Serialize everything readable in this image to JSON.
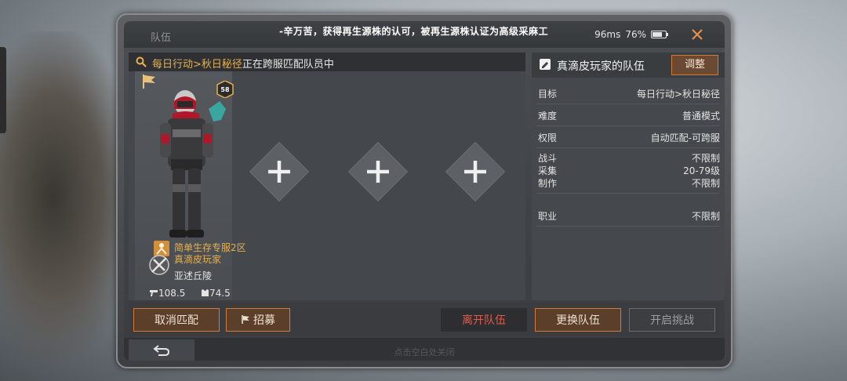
{
  "window": {
    "title": "队伍",
    "broadcast": "-辛万苦，获得再生源株的认可，被再生源株认证为高级采麻工",
    "ping": "96ms",
    "battery": "76%",
    "battery_level": 0.76
  },
  "search": {
    "highlight": "每日行动>秋日秘径",
    "status": "正在跨服匹配队员中"
  },
  "player": {
    "level": "58",
    "server": "简单生存专服2区",
    "name": "真滴皮玩家",
    "region": "亚述丘陵",
    "stat_attack": "108.5",
    "stat_defense": "74.5"
  },
  "team": {
    "name": "真滴皮玩家的队伍",
    "adjust_label": "调整",
    "rows": [
      {
        "key": "目标",
        "value": "每日行动>秋日秘径"
      },
      {
        "key": "难度",
        "value": "普通模式"
      },
      {
        "key": "权限",
        "value": "自动匹配-可跨服"
      }
    ],
    "requirements": [
      {
        "key": "战斗",
        "value": "不限制"
      },
      {
        "key": "采集",
        "value": "20-79级"
      },
      {
        "key": "制作",
        "value": "不限制"
      }
    ],
    "profession": {
      "key": "职业",
      "value": "不限制"
    }
  },
  "buttons": {
    "cancel_match": "取消匹配",
    "recruit": "招募",
    "leave_team": "离开队伍",
    "change_team": "更换队伍",
    "start_challenge": "开启挑战"
  },
  "footer": {
    "hint": "点击空白处关闭"
  },
  "colors": {
    "accent_orange": "#d17a3a",
    "highlight_gold": "#e7b050",
    "danger_red": "#e25b4a"
  }
}
